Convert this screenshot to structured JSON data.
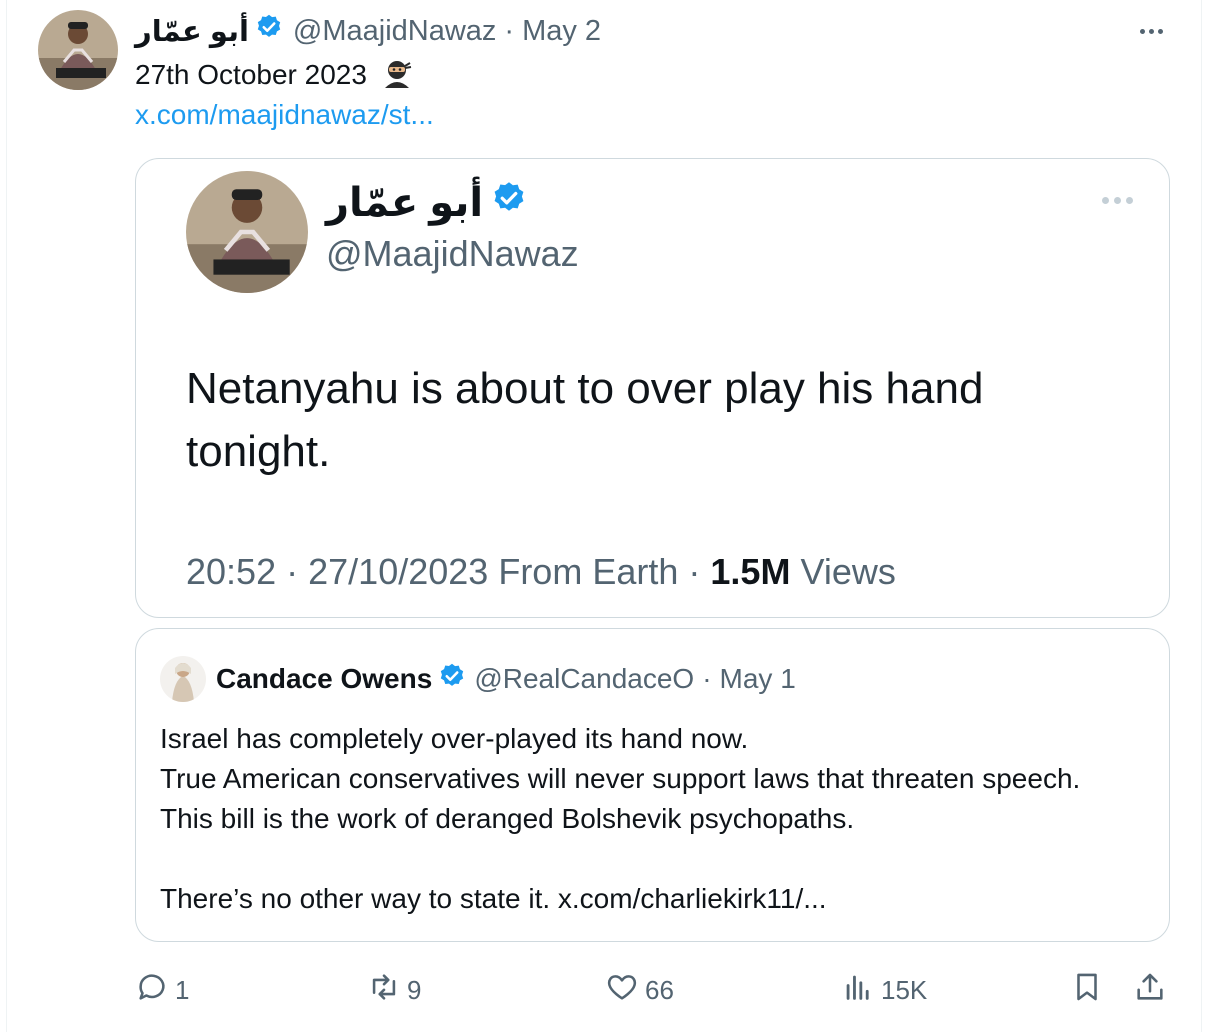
{
  "post": {
    "author_name": "أبو عمّار",
    "handle": "@MaajidNawaz",
    "separator": "·",
    "date": "May 2",
    "text": "27th October 2023",
    "emoji": "ninja-emoji",
    "link": "x.com/maajidnawaz/st..."
  },
  "embedded_image": {
    "author_name": "أبو عمّار",
    "handle": "@MaajidNawaz",
    "text": "Netanyahu is about to over play his hand tonight.",
    "time": "20:52",
    "sep1": "·",
    "date": "27/10/2023",
    "source": "From Earth",
    "sep2": "·",
    "views_count": "1.5M",
    "views_label": "Views"
  },
  "quoted": {
    "author_name": "Candace Owens",
    "handle": "@RealCandaceO",
    "separator": "·",
    "date": "May 1",
    "line1": "Israel has completely over-played its hand now.",
    "line2": "True American conservatives will never support laws that threaten speech. This bill is the work of deranged Bolshevik psychopaths.",
    "line3": "There’s no other way to state it. x.com/charliekirk11/..."
  },
  "actions": {
    "replies": "1",
    "reposts": "9",
    "likes": "66",
    "views": "15K"
  },
  "colors": {
    "verified": "#1d9bf0",
    "link": "#1d9bf0",
    "secondary_text": "#536471",
    "border": "#cfd9de"
  }
}
